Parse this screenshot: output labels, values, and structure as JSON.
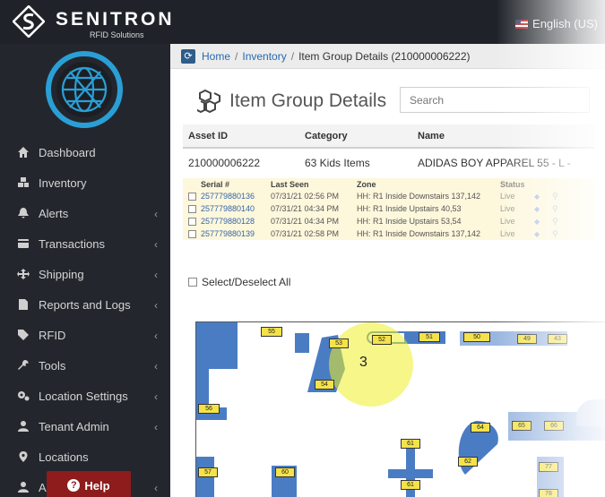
{
  "header": {
    "brand_name": "SENITRON",
    "brand_sub": "RFID Solutions",
    "language": "English (US)"
  },
  "sidebar": {
    "items": [
      {
        "label": "Dashboard",
        "icon": "home-icon",
        "chevron": false
      },
      {
        "label": "Inventory",
        "icon": "cubes-icon",
        "chevron": false
      },
      {
        "label": "Alerts",
        "icon": "bell-icon",
        "chevron": true
      },
      {
        "label": "Transactions",
        "icon": "credit-card-icon",
        "chevron": true
      },
      {
        "label": "Shipping",
        "icon": "arrows-icon",
        "chevron": true
      },
      {
        "label": "Reports and Logs",
        "icon": "file-icon",
        "chevron": true
      },
      {
        "label": "RFID",
        "icon": "tags-icon",
        "chevron": true
      },
      {
        "label": "Tools",
        "icon": "wrench-icon",
        "chevron": true
      },
      {
        "label": "Location Settings",
        "icon": "cogs-icon",
        "chevron": true
      },
      {
        "label": "Tenant Admin",
        "icon": "user-icon",
        "chevron": true
      },
      {
        "label": "Locations",
        "icon": "map-marker-icon",
        "chevron": false
      },
      {
        "label": "Ac",
        "icon": "user-icon",
        "chevron": true
      }
    ],
    "help_label": "Help"
  },
  "breadcrumb": {
    "home": "Home",
    "sep": "/",
    "inventory": "Inventory",
    "current": "Item Group Details (210000006222)"
  },
  "page": {
    "title": "Item Group Details",
    "search_placeholder": "Search"
  },
  "group_table": {
    "headers": [
      "Asset ID",
      "Category",
      "Name"
    ],
    "row": [
      "210000006222",
      "63 Kids Items",
      "ADIDAS BOY APPAREL 55 - L -"
    ]
  },
  "serials": {
    "headers": [
      "Serial #",
      "Last Seen",
      "Zone",
      "Status"
    ],
    "rows": [
      {
        "serial": "257779880136",
        "last_seen": "07/31/21 02:56 PM",
        "zone": "HH: R1 Inside Downstairs 137,142",
        "status": "Live"
      },
      {
        "serial": "257779880140",
        "last_seen": "07/31/21 04:34 PM",
        "zone": "HH: R1 Inside Upstairs 40,53",
        "status": "Live"
      },
      {
        "serial": "257779880128",
        "last_seen": "07/31/21 04:34 PM",
        "zone": "HH: R1 Inside Upstairs 53,54",
        "status": "Live"
      },
      {
        "serial": "257779880139",
        "last_seen": "07/31/21 02:58 PM",
        "zone": "HH: R1 Inside Downstairs 137,142",
        "status": "Live"
      }
    ]
  },
  "select_all_label": "Select/Deselect All",
  "floor_map": {
    "highlight_count": "3",
    "zone_tags": [
      "55",
      "53",
      "52",
      "51",
      "50",
      "49",
      "43",
      "54",
      "56",
      "64",
      "65",
      "66",
      "61",
      "62",
      "60",
      "57",
      "61",
      "77",
      "78"
    ]
  },
  "colors": {
    "sidebar_bg": "#23272d",
    "topbar_bg": "#1f2329",
    "link": "#2769b3",
    "zone_blue": "#4a7cc4",
    "tag_yellow": "#f4e24a",
    "help_red": "#8e1c1c"
  }
}
